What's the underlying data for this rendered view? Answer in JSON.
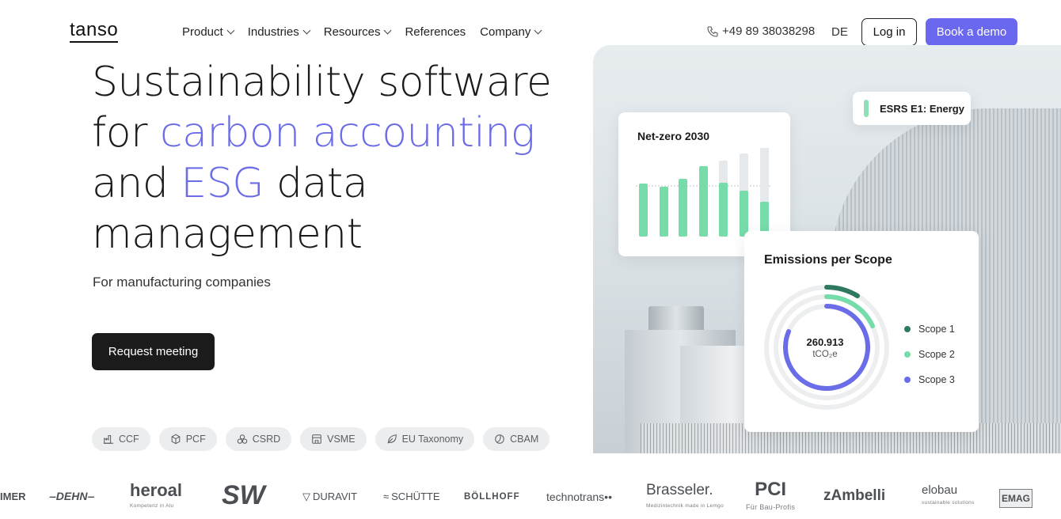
{
  "header": {
    "logo": "tanso",
    "nav": [
      {
        "label": "Product",
        "dropdown": true
      },
      {
        "label": "Industries",
        "dropdown": true
      },
      {
        "label": "Resources",
        "dropdown": true
      },
      {
        "label": "References",
        "dropdown": false
      },
      {
        "label": "Company",
        "dropdown": true
      }
    ],
    "phone": "+49 89 38038298",
    "lang": "DE",
    "login": "Log in",
    "demo": "Book a demo"
  },
  "hero": {
    "line1": "Sustainability software",
    "line2_prefix": "for ",
    "line2_accent": "carbon accounting",
    "line3_accent": "ESG",
    "line3_prefix": "and ",
    "line3_suffix": " data",
    "line4": "management",
    "subtitle": "For manufacturing companies",
    "cta": "Request meeting"
  },
  "chips": [
    {
      "label": "CCF",
      "icon": "factory-icon"
    },
    {
      "label": "PCF",
      "icon": "box-icon"
    },
    {
      "label": "CSRD",
      "icon": "shapes-icon"
    },
    {
      "label": "VSME",
      "icon": "store-icon"
    },
    {
      "label": "EU Taxonomy",
      "icon": "leaf-icon"
    },
    {
      "label": "CBAM",
      "icon": "globe-icon"
    }
  ],
  "cards": {
    "net_zero": {
      "title": "Net-zero 2030"
    },
    "esrs": {
      "label": "ESRS E1: Energy"
    },
    "emissions": {
      "title": "Emissions per Scope",
      "value": "260.913",
      "unit": "tCO₂e",
      "legend": [
        {
          "label": "Scope 1",
          "color": "#2f7a5e"
        },
        {
          "label": "Scope 2",
          "color": "#76dca9"
        },
        {
          "label": "Scope 3",
          "color": "#6b6ce8"
        }
      ]
    }
  },
  "colors": {
    "accent": "#6b6ce8",
    "green": "#76dca9",
    "dark": "#1b1b1b"
  },
  "logos": {
    "l0": "IMER",
    "l1": "DEHN",
    "l2": "heroal",
    "l2s": "Kompetenz in Alu",
    "l3": "SW",
    "l4": "DURAVIT",
    "l5": "SCHÜTTE",
    "l6": "BÖLLHOFF",
    "l7": "technotrans",
    "l8": "Brasseler.",
    "l8s": "Medizintechnik made in Lemgo",
    "l9": "PCI",
    "l9s": "Für Bau-Profis",
    "l10": "zAmbelli",
    "l11": "elobau",
    "l11s": "sustainable solutions",
    "l12": "EMAG"
  }
}
